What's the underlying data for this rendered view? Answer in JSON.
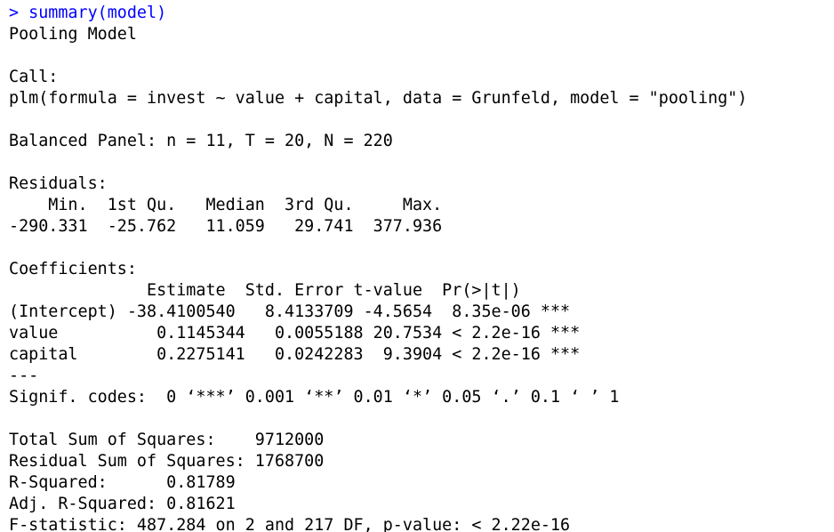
{
  "theme": {
    "command_color": "#0000ff",
    "output_color": "#000000",
    "background": "#ffffff"
  },
  "console": {
    "command": "> summary(model)",
    "lines": [
      "Pooling Model",
      "",
      "Call:",
      "plm(formula = invest ~ value + capital, data = Grunfeld, model = \"pooling\")",
      "",
      "Balanced Panel: n = 11, T = 20, N = 220",
      "",
      "Residuals:",
      "    Min.  1st Qu.   Median  3rd Qu.     Max. ",
      "-290.331  -25.762   11.059   29.741  377.936 ",
      "",
      "Coefficients:",
      "              Estimate  Std. Error t-value  Pr(>|t|)    ",
      "(Intercept) -38.4100540   8.4133709 -4.5654  8.35e-06 ***",
      "value          0.1145344   0.0055188 20.7534 < 2.2e-16 ***",
      "capital        0.2275141   0.0242283  9.3904 < 2.2e-16 ***",
      "---",
      "Signif. codes:  0 ‘***’ 0.001 ‘**’ 0.01 ‘*’ 0.05 ‘.’ 0.1 ‘ ’ 1",
      "",
      "Total Sum of Squares:    9712000",
      "Residual Sum of Squares: 1768700",
      "R-Squared:      0.81789",
      "Adj. R-Squared: 0.81621",
      "F-statistic: 487.284 on 2 and 217 DF, p-value: < 2.22e-16"
    ]
  }
}
